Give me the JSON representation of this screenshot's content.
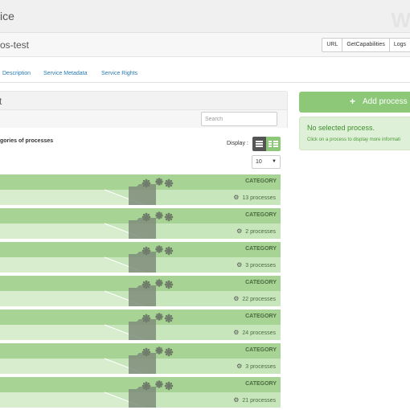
{
  "header": {
    "title": "ice",
    "logo": "W"
  },
  "service": {
    "name": "os-test",
    "buttons": [
      "URL",
      "GetCapabilities",
      "Logs"
    ]
  },
  "tabs": [
    "Description",
    "Service Metadata",
    "Service Rights"
  ],
  "panel": {
    "title": "t",
    "search_placeholder": "Search",
    "categories_label": "gories of processes",
    "display_label": "Display :",
    "page_size": "10"
  },
  "rows": [
    {
      "category": "CATEGORY",
      "count": "13 processes"
    },
    {
      "category": "CATEGORY",
      "count": "2 processes"
    },
    {
      "category": "CATEGORY",
      "count": "3 processes"
    },
    {
      "category": "CATEGORY",
      "count": "22 processes"
    },
    {
      "category": "CATEGORY",
      "count": "24 processes"
    },
    {
      "category": "CATEGORY",
      "count": "3 processes"
    },
    {
      "category": "CATEGORY",
      "count": "21 processes"
    }
  ],
  "side": {
    "add_button": "Add process",
    "no_selection": "No selected process.",
    "hint": "Click on a process to display more informati"
  },
  "colors": {
    "accent_green": "#8cc878",
    "row_dark": "#a7d494",
    "row_light": "#c8e6bc",
    "info_bg": "#dff0d8"
  },
  "icons": {
    "add": "plus-icon",
    "list_view": "list-view-icon",
    "grid_view": "grid-view-icon",
    "category": "folder-gears-icon",
    "count": "gears-icon"
  }
}
